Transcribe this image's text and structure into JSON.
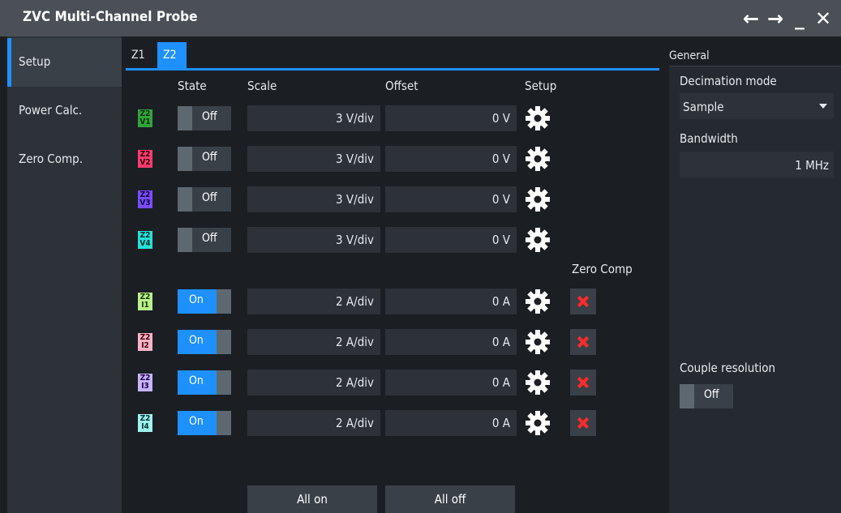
{
  "window": {
    "title": "ZVC Multi-Channel Probe",
    "controls": [
      "back-arrow",
      "forward-arrow",
      "minimize",
      "close"
    ]
  },
  "nav": {
    "items": [
      {
        "label": "Setup",
        "active": true
      },
      {
        "label": "Power Calc.",
        "active": false
      },
      {
        "label": "Zero Comp.",
        "active": false
      }
    ]
  },
  "tabs": [
    {
      "label": "Z1",
      "active": false
    },
    {
      "label": "Z2",
      "active": true
    }
  ],
  "table": {
    "headers": {
      "state": "State",
      "scale": "Scale",
      "offset": "Offset",
      "setup": "Setup",
      "zero_comp": "Zero Comp"
    },
    "voltage_rows": [
      {
        "chip_top": "Z2",
        "chip_bottom": "V1",
        "chip_color": "#2fa43a",
        "chip_text": "#0b2a08",
        "state": "Off",
        "scale": "3 V/div",
        "offset": "0 V"
      },
      {
        "chip_top": "Z2",
        "chip_bottom": "V2",
        "chip_color": "#ff3d6e",
        "chip_text": "#2a0010",
        "state": "Off",
        "scale": "3 V/div",
        "offset": "0 V"
      },
      {
        "chip_top": "Z2",
        "chip_bottom": "V3",
        "chip_color": "#7a4dff",
        "chip_text": "#12003a",
        "state": "Off",
        "scale": "3 V/div",
        "offset": "0 V"
      },
      {
        "chip_top": "Z2",
        "chip_bottom": "V4",
        "chip_color": "#28e0d8",
        "chip_text": "#00302e",
        "state": "Off",
        "scale": "3 V/div",
        "offset": "0 V"
      }
    ],
    "current_rows": [
      {
        "chip_top": "Z2",
        "chip_bottom": "I1",
        "chip_color": "#b9f28a",
        "chip_text": "#1a3300",
        "state": "On",
        "scale": "2 A/div",
        "offset": "0 A"
      },
      {
        "chip_top": "Z2",
        "chip_bottom": "I2",
        "chip_color": "#ffb3c6",
        "chip_text": "#3a0010",
        "state": "On",
        "scale": "2 A/div",
        "offset": "0 A"
      },
      {
        "chip_top": "Z2",
        "chip_bottom": "I3",
        "chip_color": "#c7b3ff",
        "chip_text": "#1a0040",
        "state": "On",
        "scale": "2 A/div",
        "offset": "0 A"
      },
      {
        "chip_top": "Z2",
        "chip_bottom": "I4",
        "chip_color": "#9ff3f0",
        "chip_text": "#003330",
        "state": "On",
        "scale": "2 A/div",
        "offset": "0 A"
      }
    ],
    "buttons": {
      "all_on": "All on",
      "all_off": "All off"
    }
  },
  "general": {
    "header": "General",
    "decimation_label": "Decimation mode",
    "decimation_value": "Sample",
    "bandwidth_label": "Bandwidth",
    "bandwidth_value": "1 MHz",
    "couple_label": "Couple resolution",
    "couple_state": "Off"
  },
  "colors": {
    "accent": "#1e90ff",
    "zero_comp_x": "#ff2b2b"
  }
}
